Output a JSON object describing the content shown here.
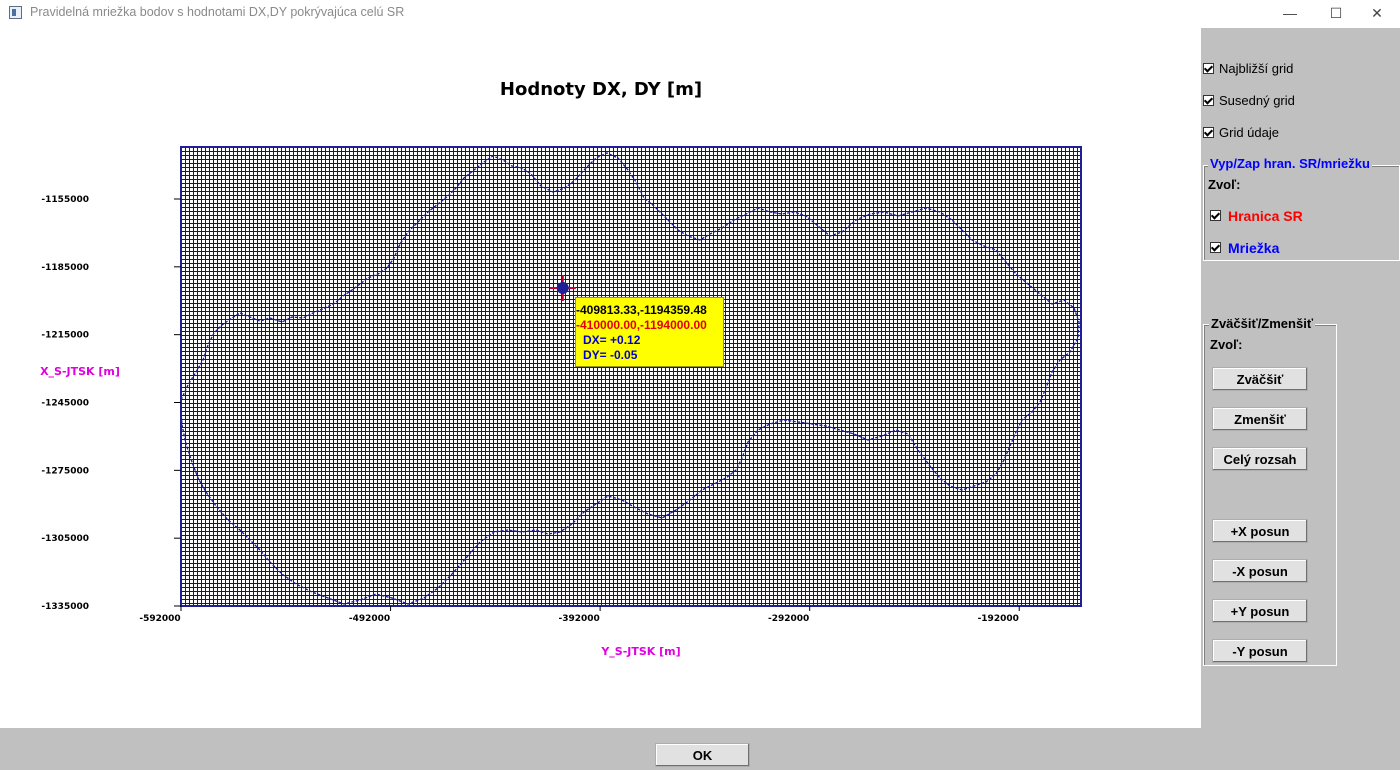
{
  "window": {
    "title": "Pravidelná mriežka bodov s hodnotami DX,DY pokrývajúca celú SR",
    "minimize_glyph": "—",
    "maximize_glyph": "☐",
    "close_glyph": "✕"
  },
  "chart_data": {
    "type": "scatter",
    "title": "Hodnoty DX, DY [m]",
    "xlabel": "Y_S-JTSK [m]",
    "ylabel": "X_S-JTSK [m]",
    "x_ticks": [
      "-592000",
      "-492000",
      "-392000",
      "-292000",
      "-192000"
    ],
    "y_ticks": [
      "-1155000",
      "-1185000",
      "-1215000",
      "-1245000",
      "-1275000",
      "-1305000",
      "-1335000"
    ],
    "xlim": [
      -592000,
      -163000
    ],
    "ylim": [
      -1335000,
      -1132000
    ],
    "grid_color": "#0000ff",
    "border_color": "#1e1e96",
    "marker": {
      "x": -409813.33,
      "y": -1194359.48,
      "color": "#cc0033"
    },
    "tooltip": {
      "coords": "-409813.33,-1194359.48",
      "grid_point": "-410000.00,-1194000.00",
      "dx": "DX= +0.12",
      "dy": "DY= -0.05"
    }
  },
  "options": {
    "najblizsi": {
      "label": "Najbližší grid",
      "checked": true
    },
    "susedny": {
      "label": "Susedný grid",
      "checked": true
    },
    "grid_udaje": {
      "label": "Grid údaje",
      "checked": true
    }
  },
  "group_boundary": {
    "title": "Vyp/Zap hran. SR/mriežku",
    "title_color": "#0000ff",
    "prompt": "Zvoľ:",
    "hranica": {
      "label": "Hranica SR",
      "color": "#ff0000",
      "checked": true
    },
    "mriezka": {
      "label": "Mriežka",
      "color": "#0000ff",
      "checked": true
    }
  },
  "group_zoom": {
    "title": "Zväčšiť/Zmenšiť",
    "prompt": "Zvoľ:",
    "zoom_in": "Zväčšiť",
    "zoom_out": "Zmenšiť",
    "full": "Celý rozsah",
    "plus_x": "+X posun",
    "minus_x": "-X posun",
    "plus_y": "+Y posun",
    "minus_y": "-Y posun"
  },
  "ok_label": "OK"
}
